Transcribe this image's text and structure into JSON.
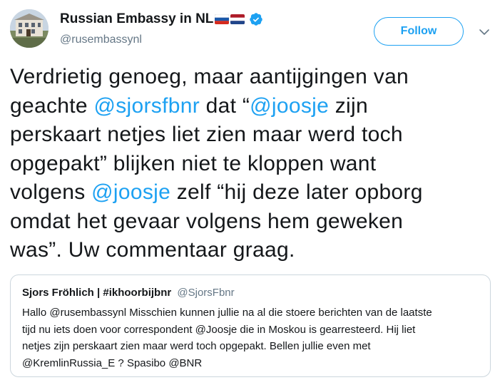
{
  "author": {
    "display_name": "Russian Embassy in NL",
    "handle": "@rusembassynl",
    "avatar": "embassy-building-avatar",
    "verified_icon": "verified-badge-icon",
    "flags": [
      "russia-flag-icon",
      "netherlands-flag-icon"
    ]
  },
  "follow_button": {
    "label": "Follow"
  },
  "menu_icon": "chevron-down-icon",
  "tweet": {
    "line1": "Verdrietig genoeg, maar aantijgingen van",
    "line2_pre": "geachte ",
    "mention_sjors": "@sjorsfbnr",
    "line2_mid": " dat “",
    "mention_joosje_1": "@joosje",
    "line2_post": " zijn",
    "line3": "perskaart netjes liet zien maar werd toch",
    "line4": "opgepakt” blijken niet te kloppen want",
    "line5_pre": "volgens ",
    "mention_joosje_2": "@joosje",
    "line5_post": " zelf “hij deze later opborg",
    "line6": "omdat het gevaar volgens hem geweken",
    "line7": "was”. Uw commentaar graag."
  },
  "quoted_tweet": {
    "name": "Sjors Fröhlich | #ikhoorbijbnr",
    "handle": "@SjorsFbnr",
    "text": "Hallo @rusembassynl Misschien kunnen jullie na al die stoere berichten van de laatste\ntijd nu iets doen voor correspondent @Joosje die in Moskou is gearresteerd. Hij liet\nnetjes zijn perskaart zien maar werd toch opgepakt. Bellen jullie even met\n@KremlinRussia_E ? Spasibo @BNR"
  },
  "colors": {
    "accent": "#1da1f2",
    "text": "#14171a",
    "secondary": "#657786",
    "border": "#ccd6dd"
  }
}
